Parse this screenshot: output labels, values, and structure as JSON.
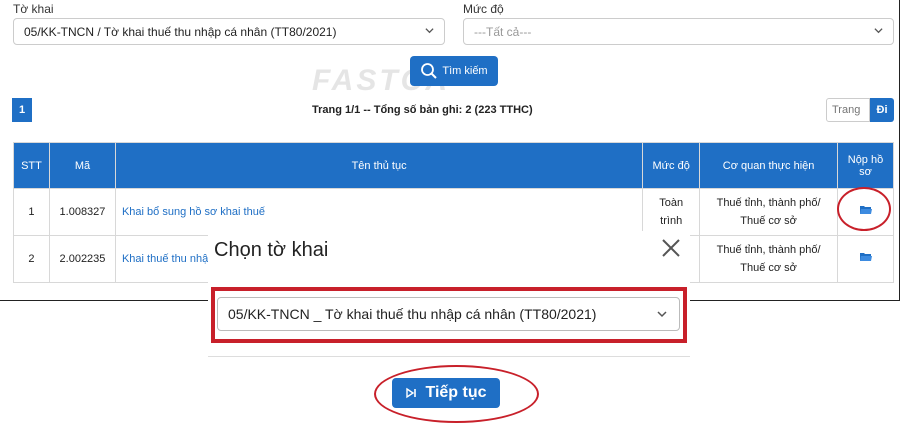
{
  "filters": {
    "to_khai_label": "Tờ khai",
    "to_khai_value": "05/KK-TNCN / Tờ khai thuế thu nhập cá nhân (TT80/2021)",
    "muc_do_label": "Mức độ",
    "muc_do_placeholder": "---Tất cả---",
    "search_label": "Tìm kiếm"
  },
  "watermark": "FASTCA",
  "pagination": {
    "current_page": "1",
    "info": "Trang 1/1 -- Tổng số bản ghi: 2 (223 TTHC)",
    "goto_placeholder": "Trang",
    "goto_button": "Đi"
  },
  "table": {
    "headers": [
      "STT",
      "Mã",
      "Tên thủ tục",
      "Mức độ",
      "Cơ quan thực hiện",
      "Nộp hồ sơ"
    ],
    "rows": [
      {
        "stt": "1",
        "ma": "1.008327",
        "ten": "Khai bổ sung hồ sơ khai thuế",
        "muc_do": "Toàn trình",
        "co_quan": "Thuế tỉnh, thành phố/ Thuế cơ sở"
      },
      {
        "stt": "2",
        "ma": "2.002235",
        "ten": "Khai thuế thu nhập cá nhân đối với tổ chức, cá nhân trả thu nhập từ tiền lương, tiền công",
        "muc_do": "",
        "co_quan": "Thuế tỉnh, thành phố/ Thuế cơ sở"
      }
    ]
  },
  "modal": {
    "title": "Chọn tờ khai",
    "select_value": "05/KK-TNCN _ Tờ khai thuế thu nhập cá nhân (TT80/2021)",
    "continue_label": "Tiếp tục"
  },
  "colors": {
    "primary": "#1f6fc5",
    "annotation": "#c8202a"
  },
  "icons": {
    "search": "search-icon",
    "folder": "folder-open-icon",
    "close": "close-icon",
    "chevron": "chevron-down-icon",
    "continue": "step-forward-icon"
  }
}
